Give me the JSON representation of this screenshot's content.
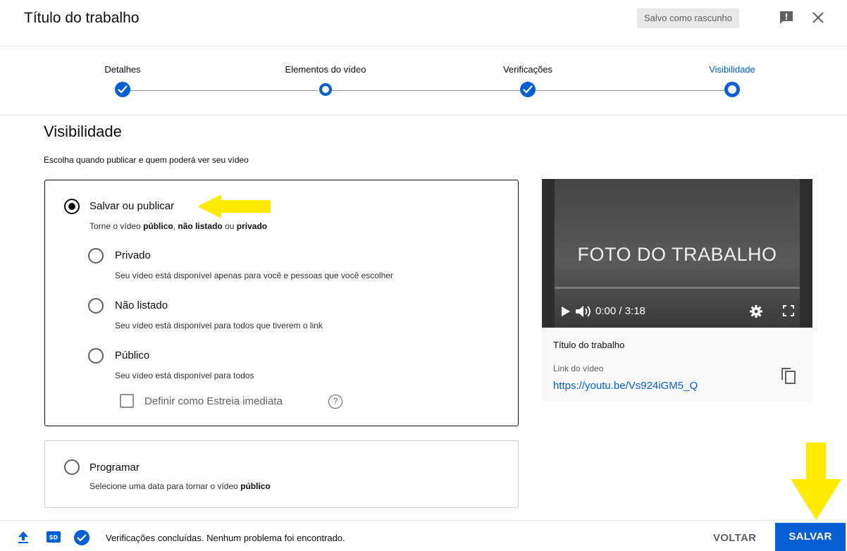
{
  "header": {
    "title": "Título do trabalho",
    "draft_status": "Salvo como rascunho"
  },
  "steps": [
    {
      "label": "Detalhes",
      "state": "done"
    },
    {
      "label": "Elementos do vídeo",
      "state": "ring"
    },
    {
      "label": "Verificações",
      "state": "done"
    },
    {
      "label": "Visibilidade",
      "state": "active"
    }
  ],
  "visibility": {
    "title": "Visibilidade",
    "subtitle": "Escolha quando publicar e quem poderá ver seu vídeo",
    "save_publish": {
      "label": "Salvar ou publicar",
      "desc_pre": "Torne o vídeo ",
      "desc_b1": "público",
      "desc_mid": ", ",
      "desc_b2": "não listado",
      "desc_mid2": " ou ",
      "desc_b3": "privado"
    },
    "options": [
      {
        "label": "Privado",
        "desc": "Seu vídeo está disponível apenas para você e pessoas que você escolher"
      },
      {
        "label": "Não listado",
        "desc": "Seu vídeo está disponível para todos que tiverem o link"
      },
      {
        "label": "Público",
        "desc": "Seu vídeo está disponível para todos"
      }
    ],
    "premiere_label": "Definir como Estreia imediata",
    "help_glyph": "?",
    "schedule": {
      "label": "Programar",
      "desc_pre": "Selecione uma data para tornar o vídeo ",
      "desc_b": "público"
    }
  },
  "preview": {
    "video_text": "FOTO DO TRABALHO",
    "time": "0:00 / 3:18",
    "title": "Título do trabalho",
    "link_label": "Link do vídeo",
    "link_url": "https://youtu.be/Vs924iGM5_Q"
  },
  "footer": {
    "status": "Verificações concluídas. Nenhum problema foi encontrado.",
    "back_label": "VOLTAR",
    "save_label": "SALVAR"
  },
  "colors": {
    "accent": "#065fd4",
    "annotation_arrow": "#ffeb00"
  }
}
